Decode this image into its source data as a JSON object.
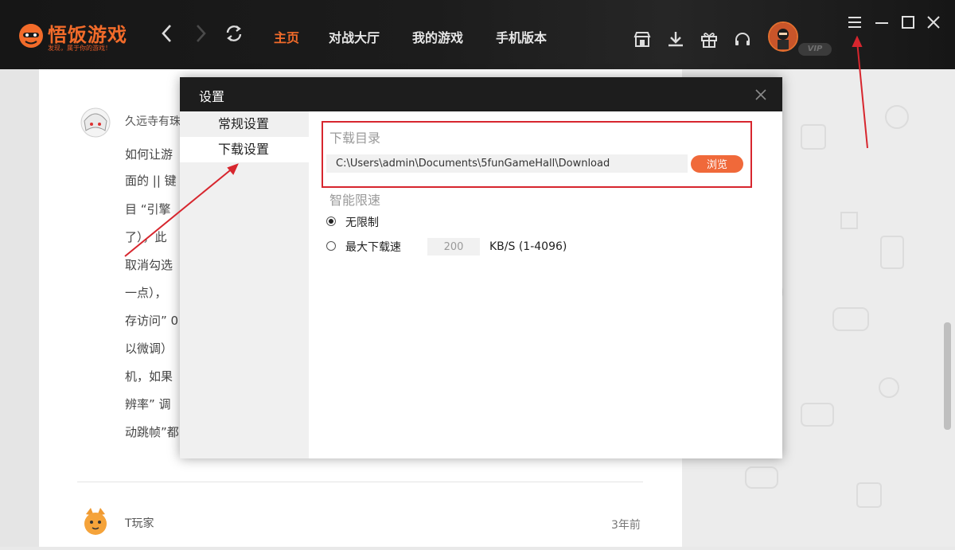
{
  "app": {
    "logo_title": "悟饭游戏",
    "logo_slogan": "发现，属于你的游戏！",
    "colors": {
      "brand": "#f26b2a",
      "highlight": "#d7262e",
      "browse": "#f0693a"
    }
  },
  "nav": {
    "back_icon": "chevron-left-icon",
    "forward_icon": "chevron-right-icon",
    "refresh_icon": "refresh-icon",
    "tabs": [
      {
        "label": "主页",
        "active": true
      },
      {
        "label": "对战大厅",
        "active": false
      },
      {
        "label": "我的游戏",
        "active": false
      },
      {
        "label": "手机版本",
        "active": false
      }
    ]
  },
  "toolbar": {
    "icons": [
      "store-icon",
      "download-icon",
      "gift-icon",
      "headset-icon"
    ],
    "vip_label": "VIP"
  },
  "window": {
    "icons": [
      "menu-icon",
      "minimize-icon",
      "maximize-icon",
      "close-icon"
    ]
  },
  "comments": [
    {
      "user": "久远寺有珠",
      "lines": [
        "如何让游",
        "面的 || 键",
        "目 “引擎",
        "了），此",
        "取消勾选",
        "一点），",
        "存访问” 0",
        "以微调）",
        "机，如果",
        "辨率” 调",
        "动跳帧”都"
      ]
    },
    {
      "user": "T玩家",
      "time": "3年前"
    }
  ],
  "settings": {
    "title": "设置",
    "menu": [
      {
        "label": "常规设置",
        "active": false
      },
      {
        "label": "下载设置",
        "active": true
      }
    ],
    "download_dir": {
      "label": "下载目录",
      "path": "C:\\Users\\admin\\Documents\\5funGameHall\\Download",
      "browse_label": "浏览"
    },
    "speed_limit": {
      "label": "智能限速",
      "options": [
        {
          "label": "无限制",
          "checked": true
        },
        {
          "label": "最大下载速",
          "checked": false
        }
      ],
      "value": "200",
      "unit": "KB/S (1-4096)"
    }
  }
}
